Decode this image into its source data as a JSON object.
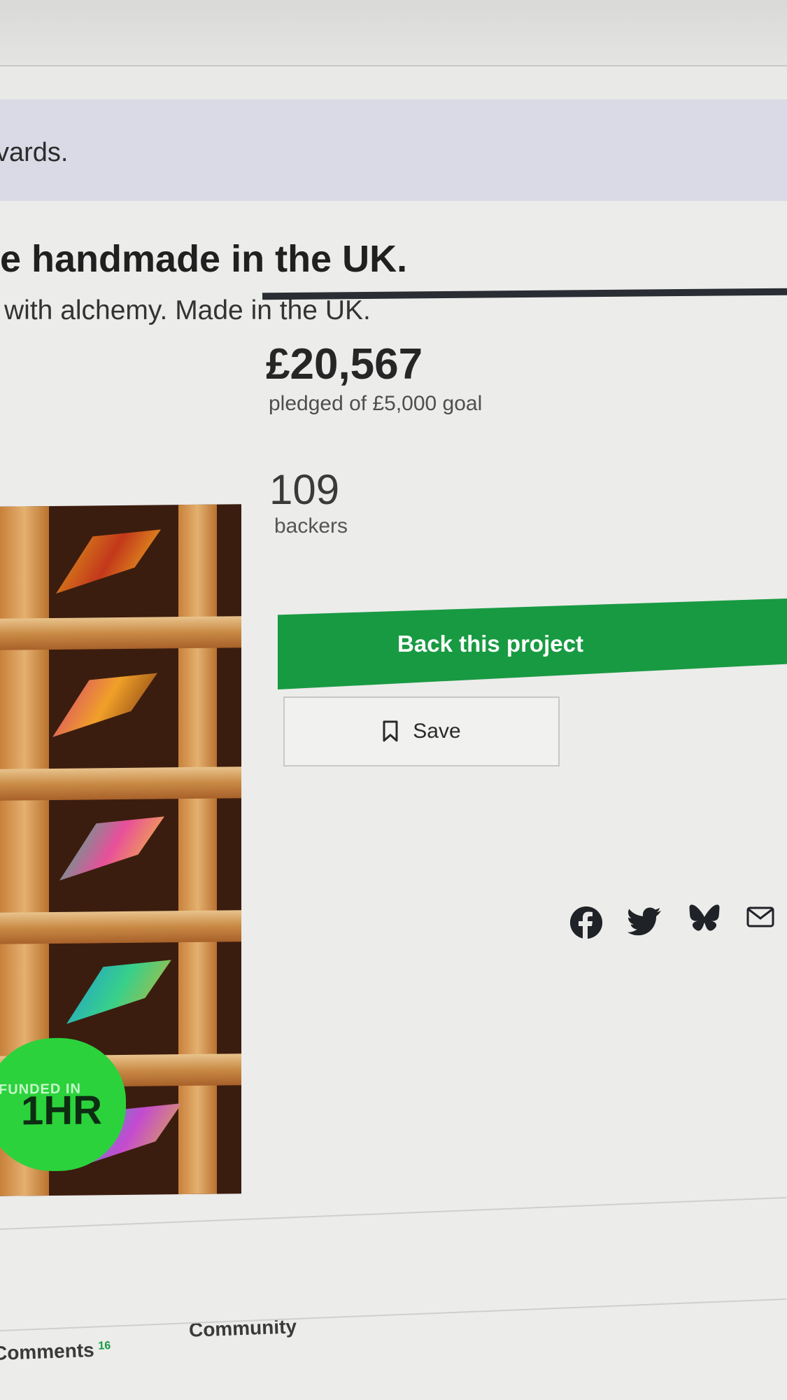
{
  "banner": {
    "text": "vards."
  },
  "project": {
    "title": "e handmade in the UK.",
    "subtitle": "with alchemy. Made in the UK."
  },
  "media": {
    "badge_small": "FUNDED IN",
    "badge_big": "1HR"
  },
  "stats": {
    "pledged_amount": "£20,567",
    "pledged_label": "pledged of £5,000 goal",
    "backers_count": "109",
    "backers_label": "backers"
  },
  "actions": {
    "back_label": "Back this project",
    "save_label": "Save",
    "share_icons": [
      "facebook-icon",
      "twitter-icon",
      "bluesky-icon",
      "email-icon"
    ]
  },
  "tabs": [
    {
      "label": "Comments",
      "count": "16"
    },
    {
      "label": "Community"
    }
  ],
  "colors": {
    "accent_green": "#189a42",
    "badge_green": "#2bd23c",
    "banner_bg": "#d9dae6"
  }
}
